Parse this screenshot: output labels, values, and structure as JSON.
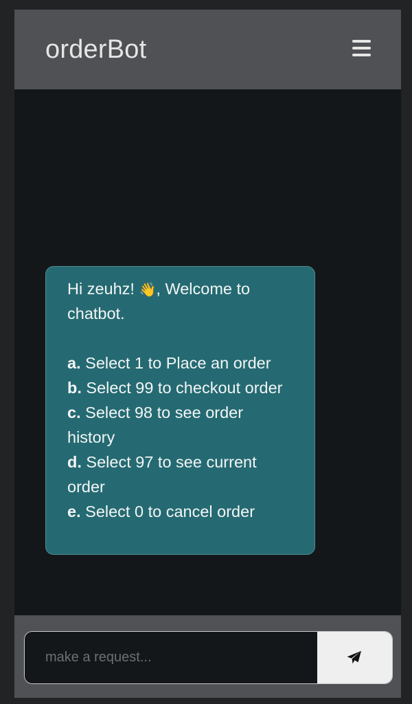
{
  "header": {
    "brand": "orderBot",
    "menu_icon": "hamburger-menu-icon"
  },
  "chat": {
    "messages": [
      {
        "greeting_prefix": "Hi zeuhz! ",
        "emoji": "👋",
        "greeting_suffix": ", Welcome to chatbot.",
        "options": [
          {
            "letter": "a.",
            "text": " Select 1 to Place an order"
          },
          {
            "letter": "b.",
            "text": " Select 99 to checkout order"
          },
          {
            "letter": "c.",
            "text": " Select 98 to see order history"
          },
          {
            "letter": "d.",
            "text": " Select 97 to see current order"
          },
          {
            "letter": "e.",
            "text": " Select 0 to cancel order"
          }
        ]
      }
    ]
  },
  "composer": {
    "placeholder": "make a request...",
    "value": "",
    "send_icon": "paper-plane-send-icon"
  },
  "colors": {
    "header_bg": "#505154",
    "chat_bg": "#141719",
    "bubble_bg": "#256a72",
    "send_button_bg": "#efefef"
  }
}
